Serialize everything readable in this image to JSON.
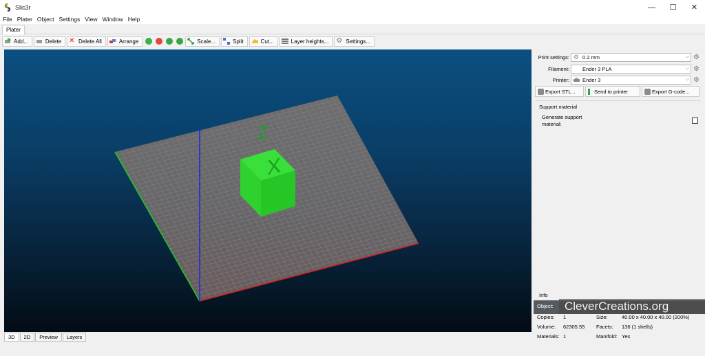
{
  "window": {
    "title": "Slic3r",
    "controls": [
      "—",
      "☐",
      "✕"
    ]
  },
  "menu": [
    "File",
    "Plater",
    "Object",
    "Settings",
    "View",
    "Window",
    "Help"
  ],
  "tab": "Plater",
  "toolbar": {
    "add": "Add...",
    "delete": "Delete",
    "delete_all": "Delete All",
    "arrange": "Arrange",
    "scale": "Scale...",
    "split": "Split",
    "cut": "Cut...",
    "layer_heights": "Layer heights...",
    "settings": "Settings..."
  },
  "view_tabs": [
    "3D",
    "2D",
    "Preview",
    "Layers"
  ],
  "settings": {
    "print_label": "Print settings:",
    "print_value": "0.2 mm",
    "filament_label": "Filament:",
    "filament_value": "Ender 3 PLA",
    "printer_label": "Printer:",
    "printer_value": "Ender 3"
  },
  "actions": {
    "export_stl": "Export STL...",
    "send_to_printer": "Send to printer",
    "export_gcode": "Export G-code..."
  },
  "support": {
    "title": "Support material",
    "generate_label": "Generate support material:",
    "checked": false
  },
  "info": {
    "title": "Info",
    "object_label": "Object:",
    "copies_label": "Copies:",
    "copies": "1",
    "size_label": "Size:",
    "size": "40.00 x 40.00 x 40.00 (200%)",
    "volume_label": "Volume:",
    "volume": "62305.55",
    "facets_label": "Facets:",
    "facets": "136 (1 shells)",
    "materials_label": "Materials:",
    "materials": "1",
    "manifold_label": "Manifold:",
    "manifold": "Yes"
  },
  "watermark": "CleverCreations.org",
  "colors": {
    "bed": "#6a6a6a",
    "cube": "#22d622",
    "x_axis": "#d62020",
    "y_axis": "#22c822",
    "z_axis": "#1e2ad8"
  }
}
